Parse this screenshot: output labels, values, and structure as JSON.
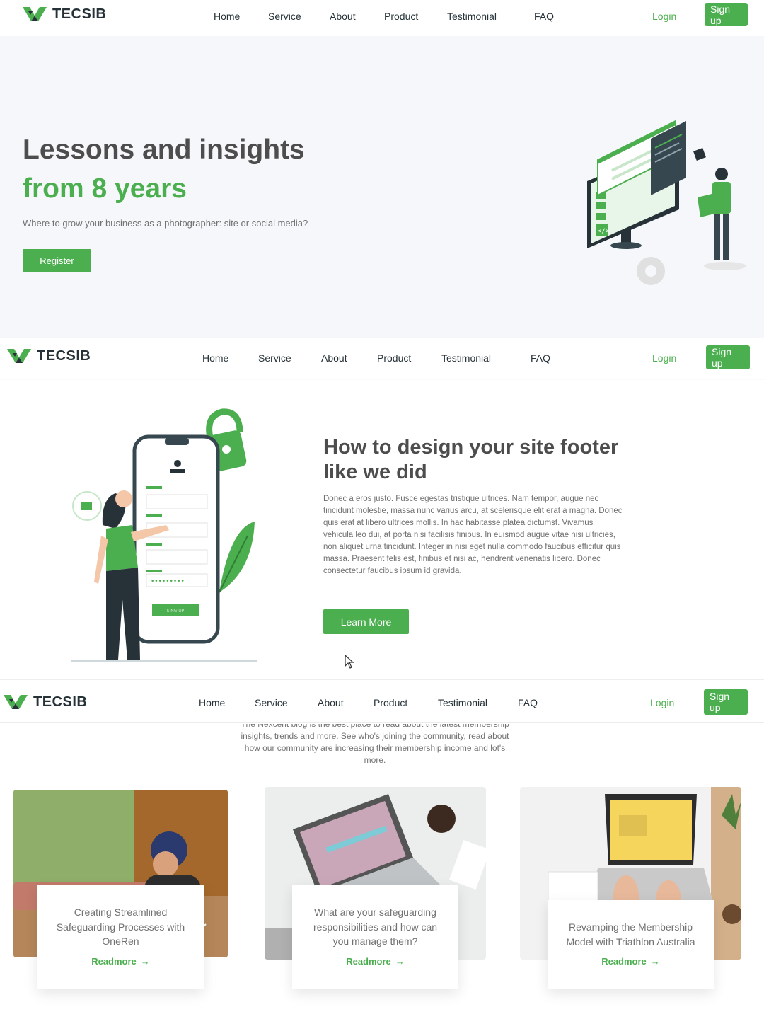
{
  "brand": {
    "name": "TECSIB"
  },
  "nav": {
    "items": [
      "Home",
      "Service",
      "About",
      "Product",
      "Testimonial",
      "FAQ"
    ],
    "login": "Login",
    "signup": "Sign up"
  },
  "hero": {
    "title_line1": "Lessons and insights",
    "title_line2": "from 8 years",
    "subtitle": "Where to grow your business as a photographer: site or social media?",
    "button": "Register"
  },
  "feature": {
    "title": "How to design your site footer like we did",
    "body": "Donec a eros justo. Fusce egestas tristique ultrices. Nam tempor, augue nec tincidunt molestie, massa nunc varius arcu, at scelerisque elit erat a magna. Donec quis erat at libero ultrices mollis. In hac habitasse platea dictumst. Vivamus vehicula leo dui, at porta nisi facilisis finibus. In euismod augue vitae nisi ultricies, non aliquet urna tincidunt. Integer in nisi eget nulla commodo faucibus efficitur quis massa. Praesent felis est, finibus et nisi ac, hendrerit venenatis libero. Donec consectetur faucibus ipsum id gravida.",
    "button": "Learn More",
    "illustration_label": "SING UP",
    "password_mask": "•••••••••"
  },
  "blog": {
    "intro": "The Nexcent blog is the best place to read about the latest membership insights, trends and more. See who's joining the community, read about how our community are increasing their membership income and lot's more.",
    "cards": [
      {
        "title": "Creating Streamlined Safeguarding Processes with OneRen",
        "link": "Readmore"
      },
      {
        "title": "What are your safeguarding responsibilities and how can you manage them?",
        "link": "Readmore"
      },
      {
        "title": "Revamping the Membership Model with Triathlon Australia",
        "link": "Readmore"
      }
    ]
  },
  "colors": {
    "primary": "#4caf4f",
    "heading": "#4d4d4d",
    "dark": "#263238",
    "muted": "#717171",
    "hero_bg": "#f5f7fa"
  }
}
